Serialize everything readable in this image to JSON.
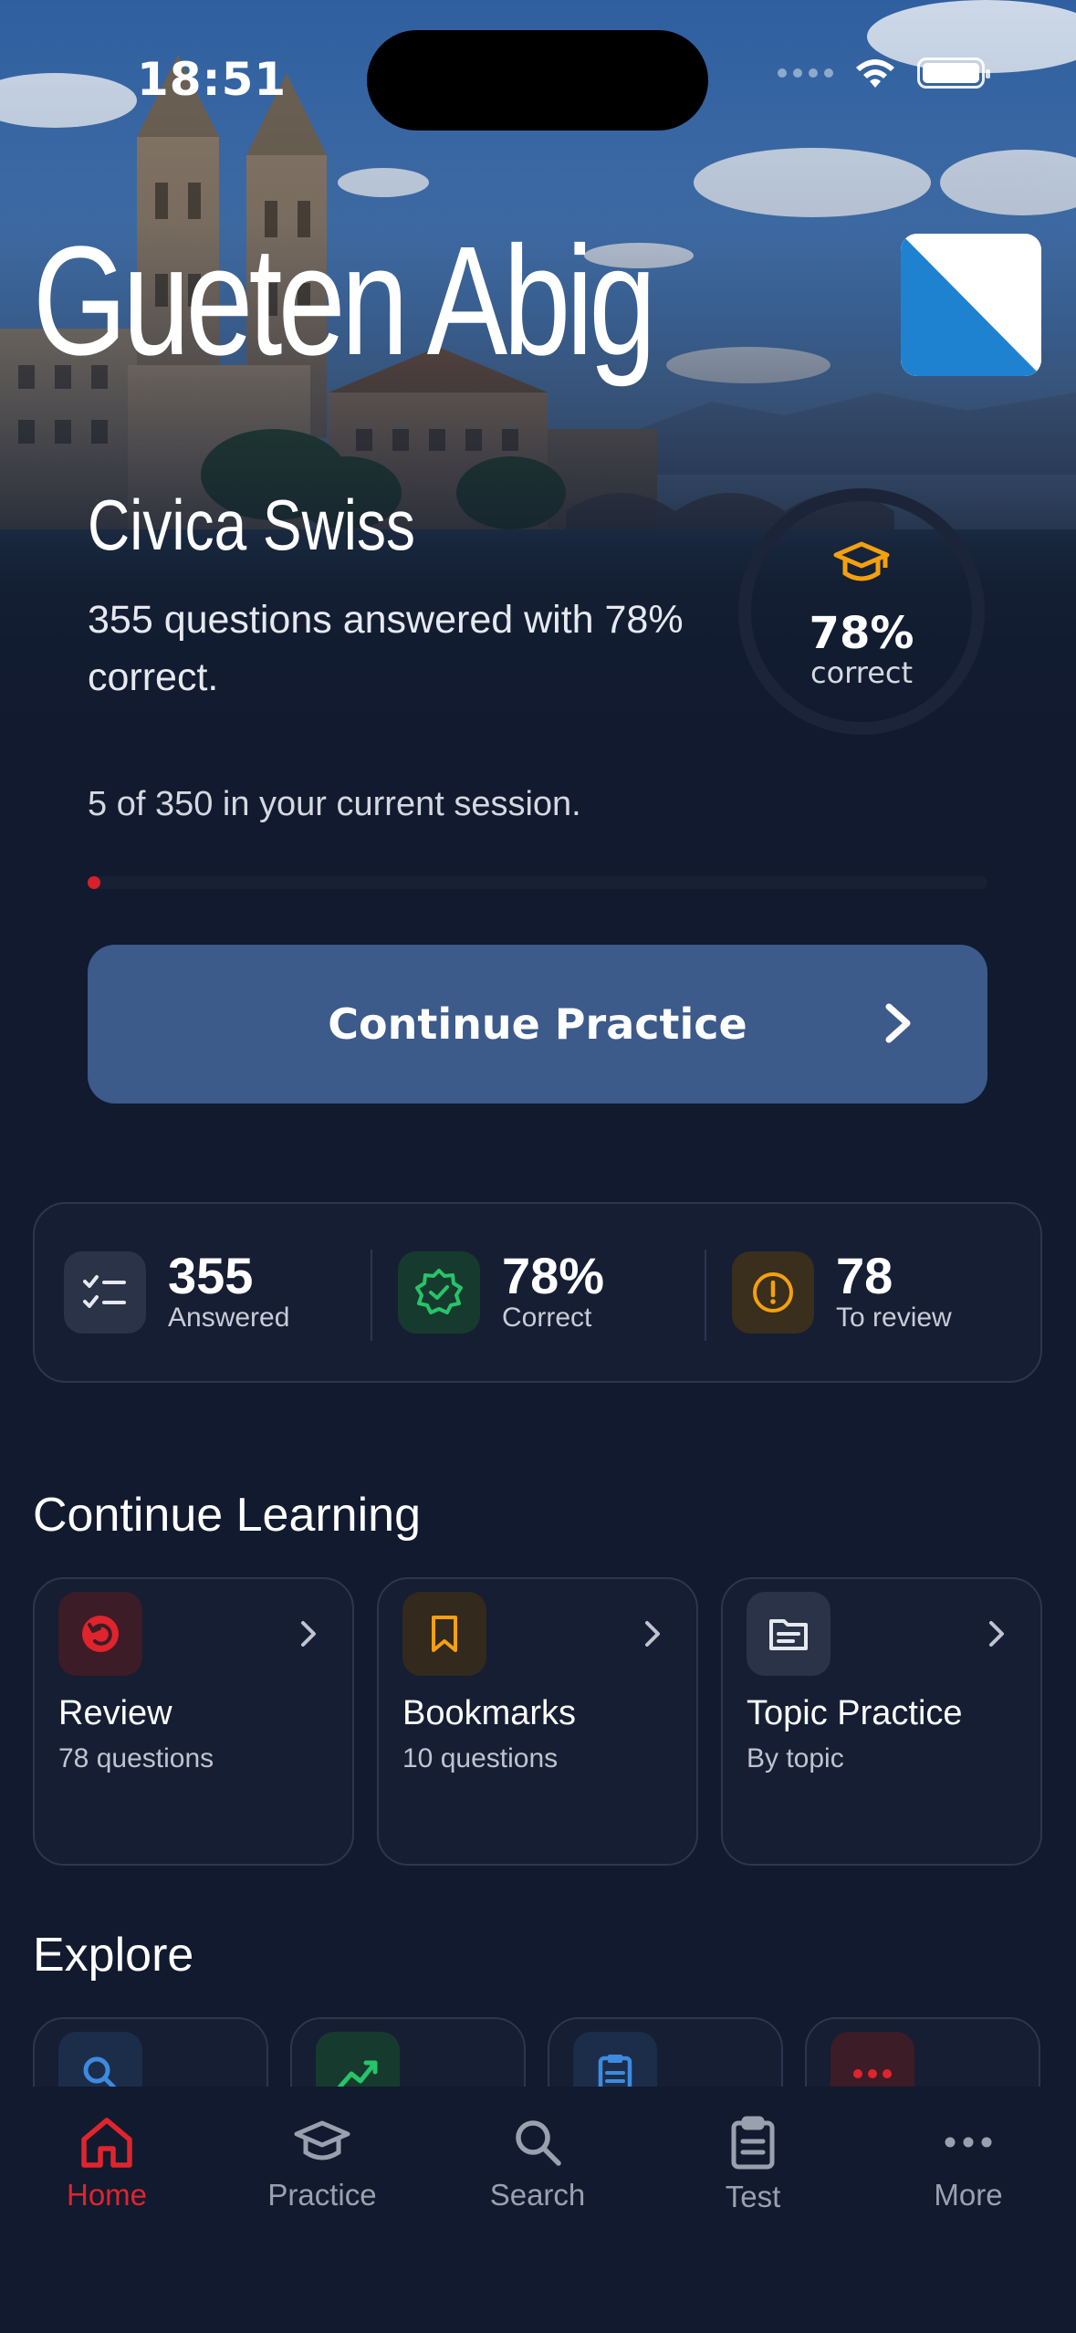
{
  "status_bar": {
    "time": "18:51"
  },
  "header": {
    "greeting": "Gueten Abig",
    "flag_icon": "zurich-flag-icon"
  },
  "exam": {
    "title": "Civica Swiss",
    "summary": "355 questions answered with 78% correct.",
    "ring_percent_label": "78%",
    "ring_caption": "correct",
    "ring_fraction": 0.78,
    "session_text": "5 of 350 in your current session.",
    "session_progress": 0.014
  },
  "continue_button": {
    "label": "Continue Practice"
  },
  "stats": [
    {
      "value": "355",
      "label": "Answered",
      "icon": "checklist-icon"
    },
    {
      "value": "78%",
      "label": "Correct",
      "icon": "verified-badge-icon"
    },
    {
      "value": "78",
      "label": "To review",
      "icon": "alert-circle-icon"
    }
  ],
  "continue_learning": {
    "title": "Continue Learning",
    "cards": [
      {
        "title": "Review",
        "subtitle": "78 questions",
        "icon": "review-icon"
      },
      {
        "title": "Bookmarks",
        "subtitle": "10 questions",
        "icon": "bookmark-icon"
      },
      {
        "title": "Topic Practice",
        "subtitle": "By topic",
        "icon": "document-icon"
      }
    ]
  },
  "explore": {
    "title": "Explore",
    "icons": [
      "search-icon",
      "trend-icon",
      "clipboard-icon",
      "more-icon"
    ]
  },
  "tabs": [
    {
      "label": "Home",
      "icon": "home-icon",
      "active": true
    },
    {
      "label": "Practice",
      "icon": "graduation-cap-icon",
      "active": false
    },
    {
      "label": "Search",
      "icon": "search-icon",
      "active": false
    },
    {
      "label": "Test",
      "icon": "clipboard-icon",
      "active": false
    },
    {
      "label": "More",
      "icon": "more-icon",
      "active": false
    }
  ],
  "colors": {
    "background": "#111a2e",
    "accent_red": "#e0242d",
    "ring_orange": "#f5a00f",
    "button_blue": "#3c5a8a",
    "flag_blue": "#1f82d0"
  }
}
